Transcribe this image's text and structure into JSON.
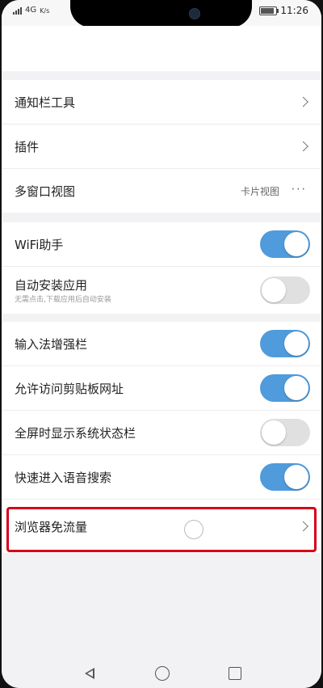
{
  "statusbar": {
    "carrier": "4G",
    "speed": "K/s",
    "time": "11:26"
  },
  "sections": [
    [
      {
        "label": "通知栏工具",
        "control": "chevron"
      },
      {
        "label": "插件",
        "control": "chevron"
      },
      {
        "label": "多窗口视图",
        "value": "卡片视图",
        "control": "more",
        "more": "···"
      }
    ],
    [
      {
        "label": "WiFi助手",
        "control": "toggle",
        "on": true
      },
      {
        "label": "自动安装应用",
        "sub": "无需点击,下载应用后自动安装",
        "control": "toggle",
        "on": false
      }
    ],
    [
      {
        "label": "输入法增强栏",
        "control": "toggle",
        "on": true
      },
      {
        "label": "允许访问剪贴板网址",
        "control": "toggle",
        "on": true
      },
      {
        "label": "全屏时显示系统状态栏",
        "control": "toggle",
        "on": false
      },
      {
        "label": "快速进入语音搜索",
        "control": "toggle",
        "on": true
      },
      {
        "label": "浏览器免流量",
        "control": "chevron"
      }
    ]
  ],
  "colors": {
    "toggle_on": "#4f9bdb",
    "highlight": "#d6001c"
  }
}
